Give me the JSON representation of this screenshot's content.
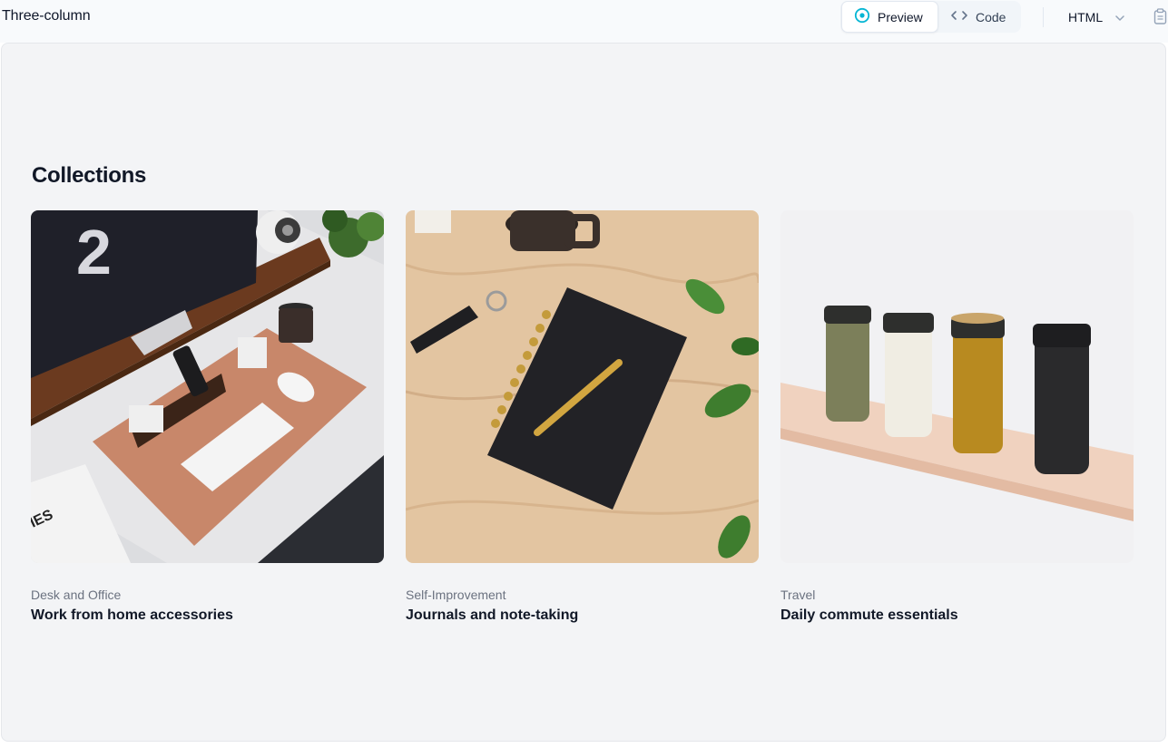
{
  "header": {
    "title": "Three-column",
    "tabs": [
      {
        "label": "Preview",
        "icon": "eye-icon",
        "active": true
      },
      {
        "label": "Code",
        "icon": "code-brackets-icon",
        "active": false
      }
    ],
    "language": {
      "selected": "HTML",
      "icon": "chevron-down-icon"
    },
    "copy_icon": "clipboard-icon",
    "accent": "#06b6d4"
  },
  "preview": {
    "section_title": "Collections",
    "collections": [
      {
        "category": "Desk and Office",
        "name": "Work from home accessories",
        "image": "desk-setup-photo"
      },
      {
        "category": "Self-Improvement",
        "name": "Journals and note-taking",
        "image": "notebook-photo"
      },
      {
        "category": "Travel",
        "name": "Daily commute essentials",
        "image": "travel-bottles-photo"
      }
    ]
  }
}
